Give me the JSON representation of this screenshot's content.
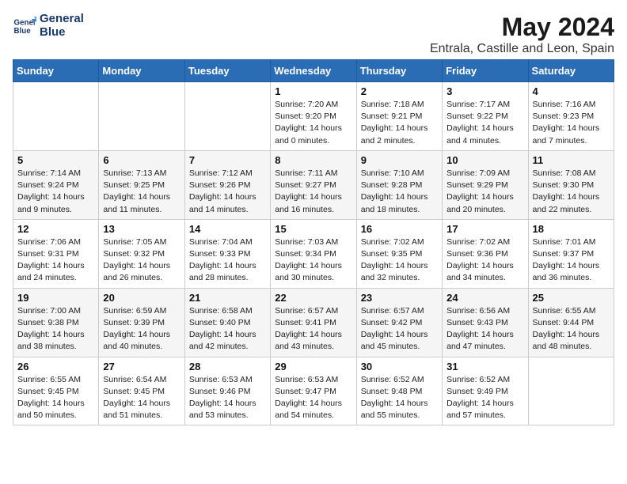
{
  "logo": {
    "line1": "General",
    "line2": "Blue"
  },
  "title": "May 2024",
  "subtitle": "Entrala, Castille and Leon, Spain",
  "weekdays": [
    "Sunday",
    "Monday",
    "Tuesday",
    "Wednesday",
    "Thursday",
    "Friday",
    "Saturday"
  ],
  "weeks": [
    [
      {
        "day": "",
        "sunrise": "",
        "sunset": "",
        "daylight": ""
      },
      {
        "day": "",
        "sunrise": "",
        "sunset": "",
        "daylight": ""
      },
      {
        "day": "",
        "sunrise": "",
        "sunset": "",
        "daylight": ""
      },
      {
        "day": "1",
        "sunrise": "Sunrise: 7:20 AM",
        "sunset": "Sunset: 9:20 PM",
        "daylight": "Daylight: 14 hours and 0 minutes."
      },
      {
        "day": "2",
        "sunrise": "Sunrise: 7:18 AM",
        "sunset": "Sunset: 9:21 PM",
        "daylight": "Daylight: 14 hours and 2 minutes."
      },
      {
        "day": "3",
        "sunrise": "Sunrise: 7:17 AM",
        "sunset": "Sunset: 9:22 PM",
        "daylight": "Daylight: 14 hours and 4 minutes."
      },
      {
        "day": "4",
        "sunrise": "Sunrise: 7:16 AM",
        "sunset": "Sunset: 9:23 PM",
        "daylight": "Daylight: 14 hours and 7 minutes."
      }
    ],
    [
      {
        "day": "5",
        "sunrise": "Sunrise: 7:14 AM",
        "sunset": "Sunset: 9:24 PM",
        "daylight": "Daylight: 14 hours and 9 minutes."
      },
      {
        "day": "6",
        "sunrise": "Sunrise: 7:13 AM",
        "sunset": "Sunset: 9:25 PM",
        "daylight": "Daylight: 14 hours and 11 minutes."
      },
      {
        "day": "7",
        "sunrise": "Sunrise: 7:12 AM",
        "sunset": "Sunset: 9:26 PM",
        "daylight": "Daylight: 14 hours and 14 minutes."
      },
      {
        "day": "8",
        "sunrise": "Sunrise: 7:11 AM",
        "sunset": "Sunset: 9:27 PM",
        "daylight": "Daylight: 14 hours and 16 minutes."
      },
      {
        "day": "9",
        "sunrise": "Sunrise: 7:10 AM",
        "sunset": "Sunset: 9:28 PM",
        "daylight": "Daylight: 14 hours and 18 minutes."
      },
      {
        "day": "10",
        "sunrise": "Sunrise: 7:09 AM",
        "sunset": "Sunset: 9:29 PM",
        "daylight": "Daylight: 14 hours and 20 minutes."
      },
      {
        "day": "11",
        "sunrise": "Sunrise: 7:08 AM",
        "sunset": "Sunset: 9:30 PM",
        "daylight": "Daylight: 14 hours and 22 minutes."
      }
    ],
    [
      {
        "day": "12",
        "sunrise": "Sunrise: 7:06 AM",
        "sunset": "Sunset: 9:31 PM",
        "daylight": "Daylight: 14 hours and 24 minutes."
      },
      {
        "day": "13",
        "sunrise": "Sunrise: 7:05 AM",
        "sunset": "Sunset: 9:32 PM",
        "daylight": "Daylight: 14 hours and 26 minutes."
      },
      {
        "day": "14",
        "sunrise": "Sunrise: 7:04 AM",
        "sunset": "Sunset: 9:33 PM",
        "daylight": "Daylight: 14 hours and 28 minutes."
      },
      {
        "day": "15",
        "sunrise": "Sunrise: 7:03 AM",
        "sunset": "Sunset: 9:34 PM",
        "daylight": "Daylight: 14 hours and 30 minutes."
      },
      {
        "day": "16",
        "sunrise": "Sunrise: 7:02 AM",
        "sunset": "Sunset: 9:35 PM",
        "daylight": "Daylight: 14 hours and 32 minutes."
      },
      {
        "day": "17",
        "sunrise": "Sunrise: 7:02 AM",
        "sunset": "Sunset: 9:36 PM",
        "daylight": "Daylight: 14 hours and 34 minutes."
      },
      {
        "day": "18",
        "sunrise": "Sunrise: 7:01 AM",
        "sunset": "Sunset: 9:37 PM",
        "daylight": "Daylight: 14 hours and 36 minutes."
      }
    ],
    [
      {
        "day": "19",
        "sunrise": "Sunrise: 7:00 AM",
        "sunset": "Sunset: 9:38 PM",
        "daylight": "Daylight: 14 hours and 38 minutes."
      },
      {
        "day": "20",
        "sunrise": "Sunrise: 6:59 AM",
        "sunset": "Sunset: 9:39 PM",
        "daylight": "Daylight: 14 hours and 40 minutes."
      },
      {
        "day": "21",
        "sunrise": "Sunrise: 6:58 AM",
        "sunset": "Sunset: 9:40 PM",
        "daylight": "Daylight: 14 hours and 42 minutes."
      },
      {
        "day": "22",
        "sunrise": "Sunrise: 6:57 AM",
        "sunset": "Sunset: 9:41 PM",
        "daylight": "Daylight: 14 hours and 43 minutes."
      },
      {
        "day": "23",
        "sunrise": "Sunrise: 6:57 AM",
        "sunset": "Sunset: 9:42 PM",
        "daylight": "Daylight: 14 hours and 45 minutes."
      },
      {
        "day": "24",
        "sunrise": "Sunrise: 6:56 AM",
        "sunset": "Sunset: 9:43 PM",
        "daylight": "Daylight: 14 hours and 47 minutes."
      },
      {
        "day": "25",
        "sunrise": "Sunrise: 6:55 AM",
        "sunset": "Sunset: 9:44 PM",
        "daylight": "Daylight: 14 hours and 48 minutes."
      }
    ],
    [
      {
        "day": "26",
        "sunrise": "Sunrise: 6:55 AM",
        "sunset": "Sunset: 9:45 PM",
        "daylight": "Daylight: 14 hours and 50 minutes."
      },
      {
        "day": "27",
        "sunrise": "Sunrise: 6:54 AM",
        "sunset": "Sunset: 9:45 PM",
        "daylight": "Daylight: 14 hours and 51 minutes."
      },
      {
        "day": "28",
        "sunrise": "Sunrise: 6:53 AM",
        "sunset": "Sunset: 9:46 PM",
        "daylight": "Daylight: 14 hours and 53 minutes."
      },
      {
        "day": "29",
        "sunrise": "Sunrise: 6:53 AM",
        "sunset": "Sunset: 9:47 PM",
        "daylight": "Daylight: 14 hours and 54 minutes."
      },
      {
        "day": "30",
        "sunrise": "Sunrise: 6:52 AM",
        "sunset": "Sunset: 9:48 PM",
        "daylight": "Daylight: 14 hours and 55 minutes."
      },
      {
        "day": "31",
        "sunrise": "Sunrise: 6:52 AM",
        "sunset": "Sunset: 9:49 PM",
        "daylight": "Daylight: 14 hours and 57 minutes."
      },
      {
        "day": "",
        "sunrise": "",
        "sunset": "",
        "daylight": ""
      }
    ]
  ]
}
